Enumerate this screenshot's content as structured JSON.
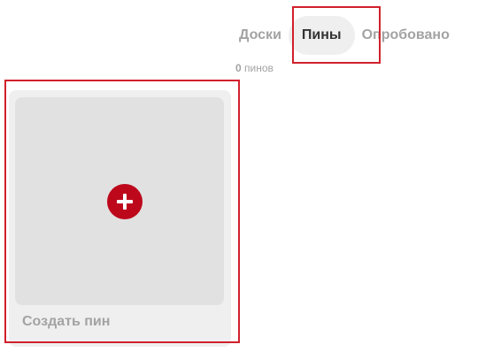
{
  "tabs": [
    {
      "label": "Доски",
      "active": false
    },
    {
      "label": "Пины",
      "active": true
    },
    {
      "label": "Опробовано",
      "active": false
    }
  ],
  "pin_count": {
    "number": "0",
    "label": "пинов"
  },
  "create_pin": {
    "label": "Создать пин",
    "icon": "plus-circle-icon",
    "accent_color": "#bd081c"
  },
  "colors": {
    "highlight": "#d0202b",
    "tab_inactive": "#a3a3a3",
    "tab_active": "#333333"
  }
}
